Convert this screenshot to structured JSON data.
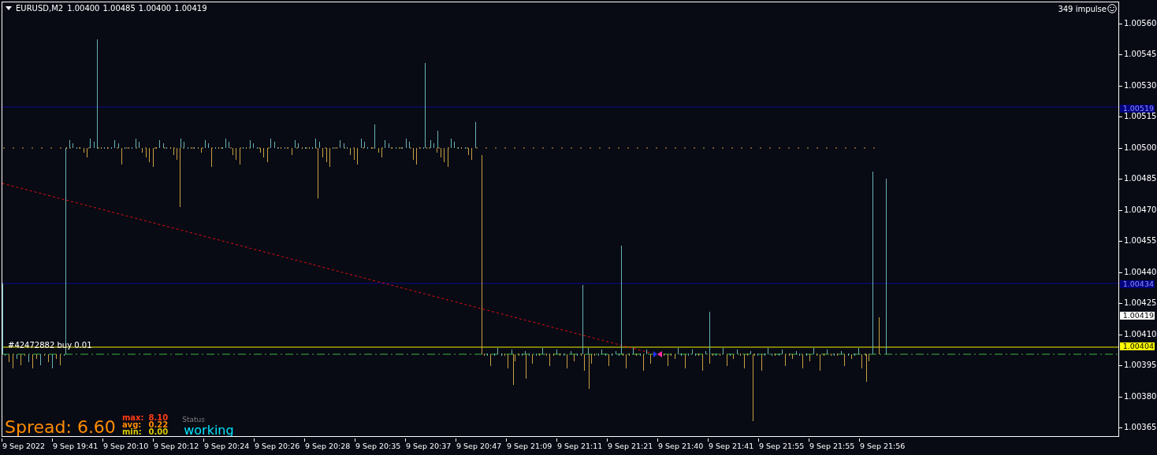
{
  "chart": {
    "symbol": "EURUSD,M2",
    "ohlc": [
      "1.00400",
      "1.00485",
      "1.00400",
      "1.00419"
    ],
    "indicator_label": "349 impulse",
    "order_label": "#42472882 buy 0.01"
  },
  "spread": {
    "label": "Spread: 6.60",
    "stats": [
      {
        "label": "max:",
        "value": "8.10",
        "color": "#ff3c14"
      },
      {
        "label": "avg:",
        "value": "0.22",
        "color": "#ff8c00"
      },
      {
        "label": "min:",
        "value": "0.00",
        "color": "#d8c800"
      }
    ],
    "status_label": "Status",
    "status": "working"
  },
  "price_axis": {
    "ticks": [
      "1.00560",
      "1.00545",
      "1.00530",
      "1.00515",
      "1.00500",
      "1.00485",
      "1.00470",
      "1.00455",
      "1.00440",
      "1.00425",
      "1.00410",
      "1.00395",
      "1.00380",
      "1.00365"
    ],
    "markers": [
      {
        "value": "1.00519",
        "kind": "line"
      },
      {
        "value": "1.00434",
        "kind": "line"
      },
      {
        "value": "1.00419",
        "kind": "bid"
      },
      {
        "value": "1.00404",
        "kind": "order"
      }
    ]
  },
  "time_axis": [
    "9 Sep 2022",
    "9 Sep 19:41",
    "9 Sep 20:10",
    "9 Sep 20:12",
    "9 Sep 20:24",
    "9 Sep 20:26",
    "9 Sep 20:28",
    "9 Sep 20:35",
    "9 Sep 20:37",
    "9 Sep 20:47",
    "9 Sep 21:09",
    "9 Sep 21:11",
    "9 Sep 21:21",
    "9 Sep 21:40",
    "9 Sep 21:41",
    "9 Sep 21:55",
    "9 Sep 21:55",
    "9 Sep 21:56"
  ]
}
